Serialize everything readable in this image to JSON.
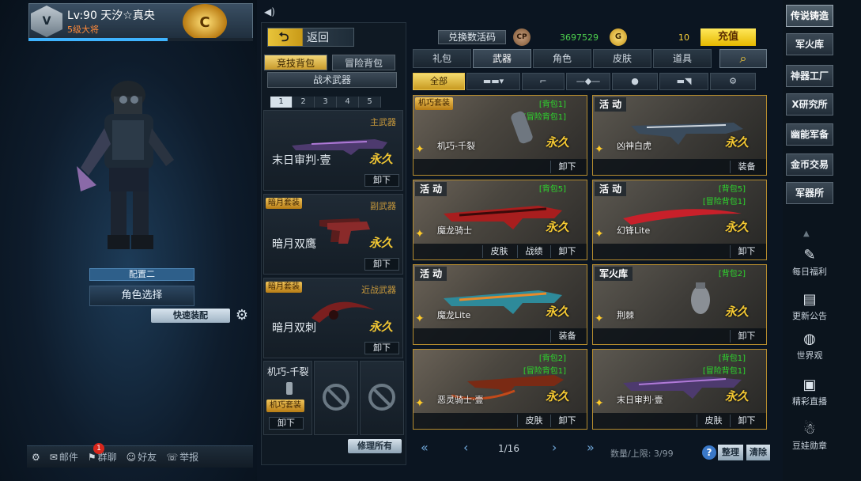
{
  "player": {
    "level_name": "Lv:90 天汐☆真央",
    "rank": "5级大将",
    "xp_fraction": 0.62
  },
  "character": {
    "config_label": "配置二",
    "role_select": "角色选择",
    "quick_equip": "快速装配"
  },
  "bottom_bar": {
    "mail": "邮件",
    "mail_count": "1",
    "group": "群聊",
    "friends": "好友",
    "report": "举报"
  },
  "back": {
    "label": "返回"
  },
  "bags": {
    "tab1": "竞技背包",
    "tab2": "冒险背包",
    "tactical": "战术武器",
    "pages": [
      "1",
      "2",
      "3",
      "4",
      "5"
    ]
  },
  "slots": [
    {
      "category": "主武器",
      "tag": "",
      "name": "末日审判·壹",
      "perm": "永久",
      "btn": "卸下"
    },
    {
      "category": "副武器",
      "tag": "暗月套装",
      "name": "暗月双鹰",
      "perm": "永久",
      "btn": "卸下"
    },
    {
      "category": "近战武器",
      "tag": "暗月套装",
      "name": "暗月双刺",
      "perm": "永久",
      "btn": "卸下"
    }
  ],
  "sub_slot": {
    "name": "机巧-千裂",
    "tag": "机巧套装",
    "btn": "卸下"
  },
  "repair": "修理所有",
  "currency": {
    "redeem": "兑换数活码",
    "cp_icon": "CP",
    "cp_value": "3697529",
    "g_icon": "G",
    "g_value": "10",
    "recharge": "充值"
  },
  "cat_tabs": [
    "礼包",
    "武器",
    "角色",
    "皮肤",
    "道具"
  ],
  "filters": {
    "all": "全部"
  },
  "items": [
    {
      "tag": "机巧套装",
      "tag_type": "suit",
      "bag": "[背包1]",
      "bag2": "[冒险背包1]",
      "name": "机巧-千裂",
      "perm": "永久",
      "buttons": [
        "卸下"
      ]
    },
    {
      "tag": "活 动",
      "tag_type": "event",
      "bag": "",
      "bag2": "",
      "name": "凶神白虎",
      "perm": "永久",
      "buttons": [
        "装备"
      ]
    },
    {
      "tag": "活 动",
      "tag_type": "event",
      "bag": "[背包5]",
      "bag2": "",
      "name": "魔龙骑士",
      "perm": "永久",
      "buttons": [
        "皮肤",
        "战绩",
        "卸下"
      ]
    },
    {
      "tag": "活 动",
      "tag_type": "event",
      "bag": "[背包5]",
      "bag2": "[冒险背包1]",
      "name": "幻锋Lite",
      "perm": "永久",
      "buttons": [
        "卸下"
      ]
    },
    {
      "tag": "活 动",
      "tag_type": "event",
      "bag": "",
      "bag2": "",
      "name": "魔龙Lite",
      "perm": "永久",
      "buttons": [
        "装备"
      ]
    },
    {
      "tag": "军火库",
      "tag_type": "event",
      "bag": "[背包2]",
      "bag2": "",
      "name": "荆棘",
      "perm": "永久",
      "buttons": [
        "卸下"
      ]
    },
    {
      "tag": "",
      "tag_type": "",
      "bag": "[背包2]",
      "bag2": "[冒险背包1]",
      "name": "恶灵骑士·壹",
      "perm": "永久",
      "buttons": [
        "皮肤",
        "卸下"
      ]
    },
    {
      "tag": "",
      "tag_type": "",
      "bag": "[背包1]",
      "bag2": "[冒险背包1]",
      "name": "末日审判·壹",
      "perm": "永久",
      "buttons": [
        "皮肤",
        "卸下"
      ]
    }
  ],
  "pager": {
    "text": "1/16",
    "qty": "数量/上限: 3/99",
    "help": "?",
    "sort": "整理",
    "clear": "清除"
  },
  "right_nav": [
    "传说铸造",
    "军火库",
    "神器工厂",
    "X研究所",
    "幽能军备",
    "金币交易",
    "军器所"
  ],
  "right_icons": [
    "每日福利",
    "更新公告",
    "世界观",
    "精彩直播",
    "豆娃勋章"
  ],
  "colors": {
    "gold": "#f5c933",
    "green": "#2dd92d",
    "accent": "#e8c24a"
  }
}
